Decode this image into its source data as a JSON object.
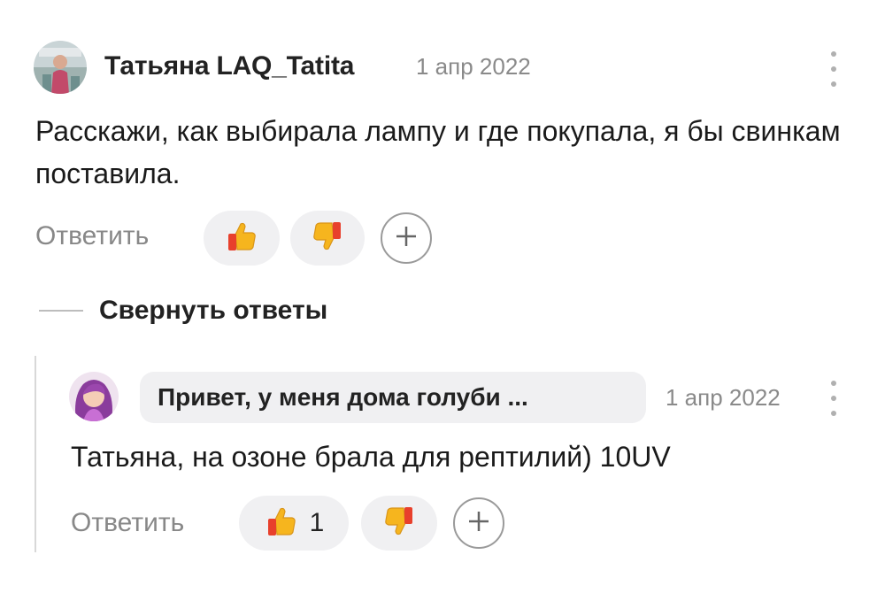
{
  "comment": {
    "author": "Татьяна LAQ_Tatita",
    "date": "1 апр 2022",
    "text": "Расскажи, как выбирала лампу и где покупала, я бы свинкам поставила.",
    "reply_label": "Ответить",
    "like_count": "",
    "icons": {
      "like": "thumbs-up-icon",
      "dislike": "thumbs-down-icon",
      "add": "plus-icon",
      "menu": "kebab-menu-icon"
    }
  },
  "collapse_label": "Свернуть ответы",
  "reply": {
    "quote": "Привет, у меня дома голуби ...",
    "date": "1 апр 2022",
    "text": "Татьяна, на озоне брала для рептилий) 10UV",
    "reply_label": "Ответить",
    "like_count": "1"
  },
  "colors": {
    "accent_thumb": "#f6b51e",
    "thumb_cuff": "#e8402c",
    "pill_bg": "#f0f0f2",
    "muted_text": "#888888"
  }
}
